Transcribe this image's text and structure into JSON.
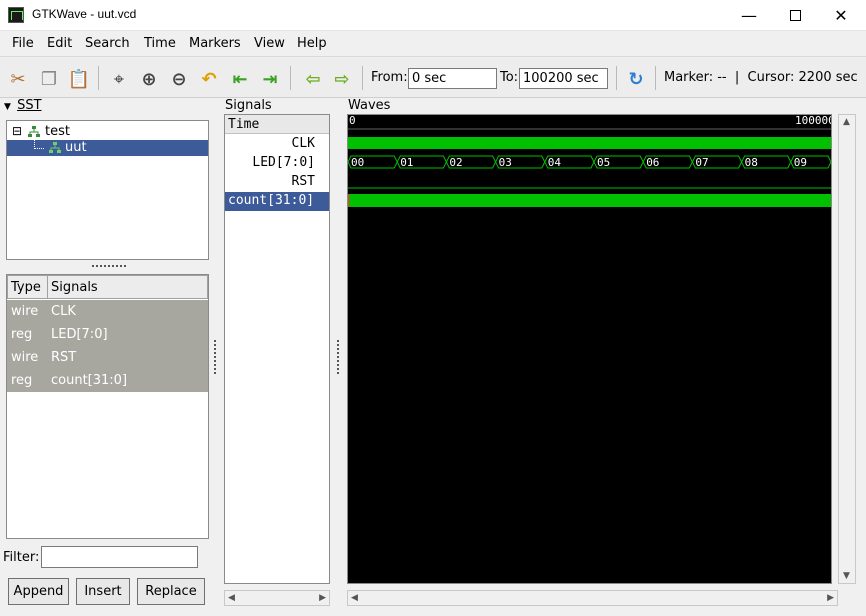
{
  "window": {
    "title": "GTKWave - uut.vcd"
  },
  "menu": [
    "File",
    "Edit",
    "Search",
    "Time",
    "Markers",
    "View",
    "Help"
  ],
  "toolbar": {
    "from_label": "From:",
    "from_value": "0 sec",
    "to_label": "To:",
    "to_value": "100200 sec",
    "marker_text": "Marker: --  |  Cursor: 2200 sec"
  },
  "sst": {
    "header": "SST",
    "tree": [
      {
        "label": "test",
        "expander": "⊟",
        "selected": false
      },
      {
        "label": "uut",
        "selected": true
      }
    ]
  },
  "signal_table": {
    "headers": [
      "Type",
      "Signals"
    ],
    "rows": [
      {
        "type": "wire",
        "name": "CLK"
      },
      {
        "type": "reg",
        "name": "LED[7:0]"
      },
      {
        "type": "wire",
        "name": "RST"
      },
      {
        "type": "reg",
        "name": "count[31:0]"
      }
    ]
  },
  "filter": {
    "label": "Filter:",
    "value": ""
  },
  "buttons": {
    "append": "Append",
    "insert": "Insert",
    "replace": "Replace"
  },
  "signals_panel": {
    "header": "Signals",
    "time_label": "Time",
    "names": [
      "CLK",
      "LED[7:0]",
      "RST",
      "count[31:0]"
    ],
    "selected_index": 3
  },
  "waves_panel": {
    "header": "Waves",
    "ruler_start": "0",
    "ruler_end": "100000",
    "led_values": [
      "00",
      "01",
      "02",
      "03",
      "04",
      "05",
      "06",
      "07",
      "08",
      "09"
    ],
    "colors": {
      "wave": "#00c000",
      "bg": "#000000",
      "selection": "#3d5a99"
    }
  }
}
